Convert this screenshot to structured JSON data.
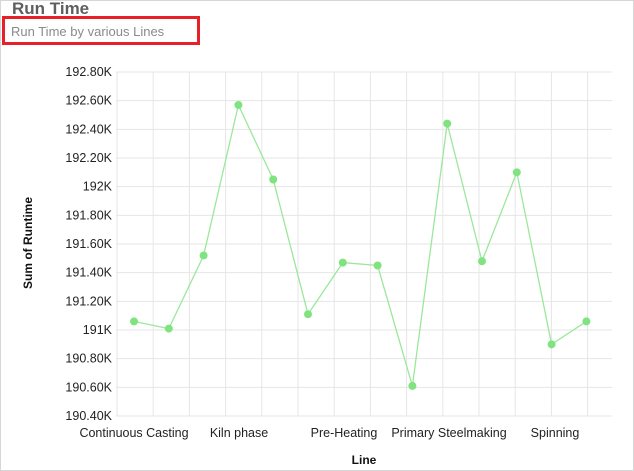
{
  "header": {
    "title": "Run Time",
    "subtitle": "Run Time by various Lines"
  },
  "colors": {
    "line": "#9be89b",
    "marker": "#7fe37f",
    "grid": "#e6e6e6",
    "highlight": "#e8202a"
  },
  "chart_data": {
    "type": "line",
    "title": "Run Time",
    "subtitle": "Run Time by various Lines",
    "xlabel": "Line",
    "ylabel": "Sum of Runtime",
    "ylim": [
      190400,
      192800
    ],
    "yticks": [
      190400,
      190600,
      190800,
      191000,
      191200,
      191400,
      191600,
      191800,
      192000,
      192200,
      192400,
      192600,
      192800
    ],
    "ytick_labels": [
      "190.40K",
      "190.60K",
      "190.80K",
      "191K",
      "191.20K",
      "191.40K",
      "191.60K",
      "191.80K",
      "192K",
      "192.20K",
      "192.40K",
      "192.60K",
      "192.80K"
    ],
    "x_tick_labels": [
      "Continuous Casting",
      "Kiln phase",
      "Pre-Heating",
      "Primary Steelmaking",
      "Spinning"
    ],
    "grid": true,
    "legend": "none",
    "series": [
      {
        "values": [
          191060,
          191010,
          191520,
          192570,
          192050,
          191110,
          191470,
          191450,
          190610,
          192440,
          191480,
          192100,
          190900,
          191060
        ]
      }
    ]
  }
}
